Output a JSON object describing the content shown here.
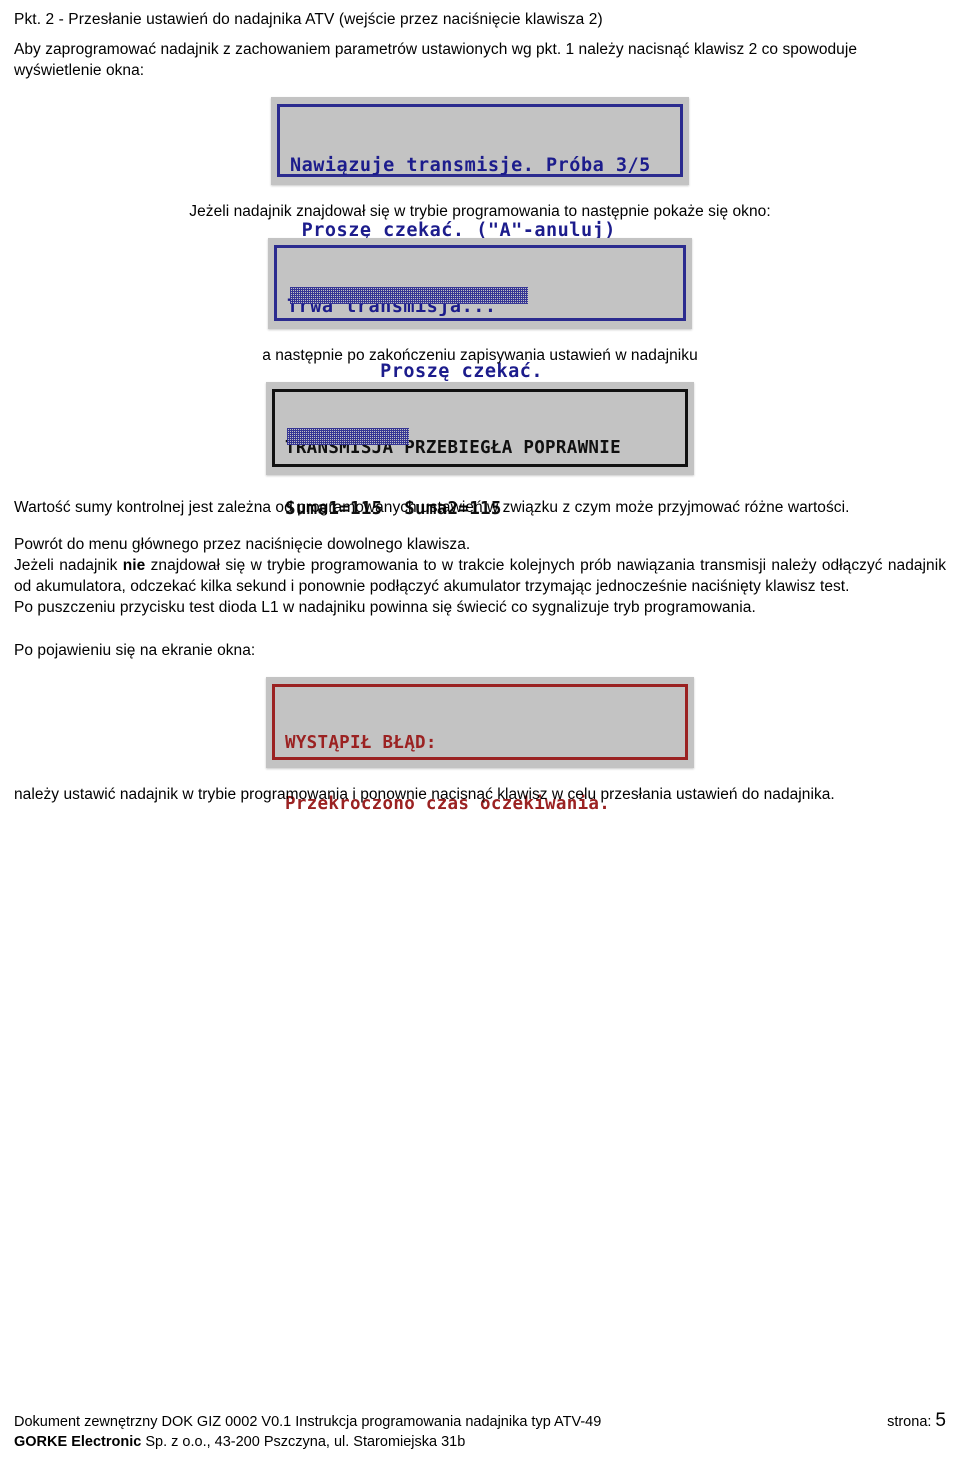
{
  "document": {
    "section_title": "Pkt. 2  - Przesłanie ustawień do nadajnika ATV (wejście przez naciśnięcie klawisza 2)",
    "intro_paragraph": "Aby zaprogramować nadajnik z zachowaniem parametrów ustawionych wg pkt. 1 należy nacisnąć klawisz 2 co spowoduje wyświetlenie okna:",
    "caption_after_first_lcd": "Jeżeli nadajnik znajdował się w trybie programowania to następnie pokaże się okno:",
    "caption_after_second_lcd": "a następnie po zakończeniu zapisywania ustawień w nadajniku",
    "checksum_note": "Wartość sumy kontrolnej jest zależna od programowanych ustawień w związku z czym może przyjmować różne wartości.",
    "return_note": "Powrót do menu głównego przez naciśnięcie dowolnego klawisza.",
    "not_prog_mode_part1": "Jeżeli nadajnik ",
    "not_prog_mode_bold": "nie",
    "not_prog_mode_part2": " znajdował się w trybie programowania to w trakcie kolejnych prób nawiązania transmisji należy odłączyć nadajnik od akumulatora, odczekać kilka sekund i ponownie podłączyć akumulator trzymając jednocześnie naciśnięty klawisz test.",
    "led_note": "Po puszczeniu przycisku test dioda L1 w nadajniku powinna się świecić co sygnalizuje tryb programowania.",
    "error_intro": "Po pojawieniu się na ekranie okna:",
    "error_resolution": "należy ustawić nadajnik w trybie programowania i ponownie nacisnąć klawisz w celu przesłania ustawień do nadajnika."
  },
  "lcd_panels": {
    "attempt": {
      "line1": "Nawiązuje transmisje. Próba 3/5",
      "line2": " Proszę czekać. (\"A\"-anuluj)",
      "progress_visible": true,
      "border_color": "#2b2b8f",
      "text_color": "#1c1c8c",
      "screen_color": "#c3c3c3"
    },
    "progress": {
      "line1": "Trwa transmisja...",
      "line2": "        Proszę czekać.",
      "progress_visible": true,
      "border_color": "#2b2b8f",
      "text_color": "#1c1c8c",
      "screen_color": "#c3c3c3"
    },
    "success": {
      "line1": "TRANSMISJA PRZEBIEGŁA POPRAWNIE",
      "line2": "Suma1=115  Suma2=115",
      "progress_visible": false,
      "border_color": "#111111",
      "text_color": "#101010",
      "screen_color": "#c3c3c3"
    },
    "error": {
      "line1": "WYSTĄPIŁ BŁĄD:",
      "line2": "Przekroczono czas oczekiwania.",
      "progress_visible": false,
      "border_color": "#9b2222",
      "text_color": "#9b2222",
      "screen_color": "#c3c3c3"
    }
  },
  "footer": {
    "document_ref": "Dokument zewnętrzny DOK GIZ 0002 V0.1 Instrukcja programowania nadajnika typ ATV-49",
    "page_label": "strona:",
    "page_number": "5",
    "company": "GORKE Electronic",
    "company_address": " Sp. z o.o., 43-200 Pszczyna, ul. Staromiejska 31b"
  }
}
